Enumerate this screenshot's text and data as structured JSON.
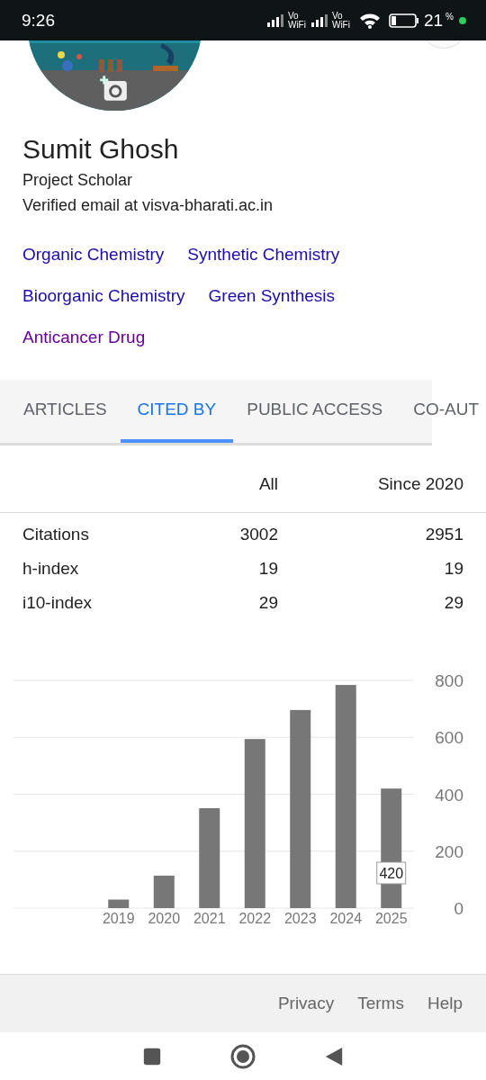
{
  "status_bar": {
    "time": "9:26",
    "sim_labels": [
      "Vo\nWiFi",
      "Vo\nWiFi"
    ],
    "battery_text": "21",
    "battery_unit": "%"
  },
  "profile": {
    "name": "Sumit Ghosh",
    "affiliation": "Project Scholar",
    "email": "Verified email at visva-bharati.ac.in",
    "interests": [
      {
        "label": "Organic Chemistry",
        "visited": false
      },
      {
        "label": "Synthetic Chemistry",
        "visited": false
      },
      {
        "label": "Bioorganic Chemistry",
        "visited": false
      },
      {
        "label": "Green Synthesis",
        "visited": false
      },
      {
        "label": "Anticancer Drug",
        "visited": true
      }
    ]
  },
  "tabs": [
    {
      "label": "ARTICLES",
      "selected": false
    },
    {
      "label": "CITED BY",
      "selected": true
    },
    {
      "label": "PUBLIC ACCESS",
      "selected": false
    },
    {
      "label": "CO-AUT",
      "selected": false
    }
  ],
  "stats": {
    "columns": [
      "All",
      "Since 2020"
    ],
    "rows": [
      {
        "label": "Citations",
        "all": "3002",
        "since": "2951"
      },
      {
        "label": "h-index",
        "all": "19",
        "since": "19"
      },
      {
        "label": "i10-index",
        "all": "29",
        "since": "29"
      }
    ]
  },
  "chart_data": {
    "type": "bar",
    "categories": [
      "2019",
      "2020",
      "2021",
      "2022",
      "2023",
      "2024",
      "2025"
    ],
    "values": [
      30,
      114,
      351,
      594,
      696,
      784,
      420
    ],
    "ylim": [
      0,
      800
    ],
    "yticks": [
      0,
      200,
      400,
      600,
      800
    ],
    "grid": true,
    "annotations": [
      {
        "x": "2025",
        "text": "420"
      }
    ]
  },
  "footer": {
    "links": [
      "Privacy",
      "Terms",
      "Help"
    ]
  }
}
